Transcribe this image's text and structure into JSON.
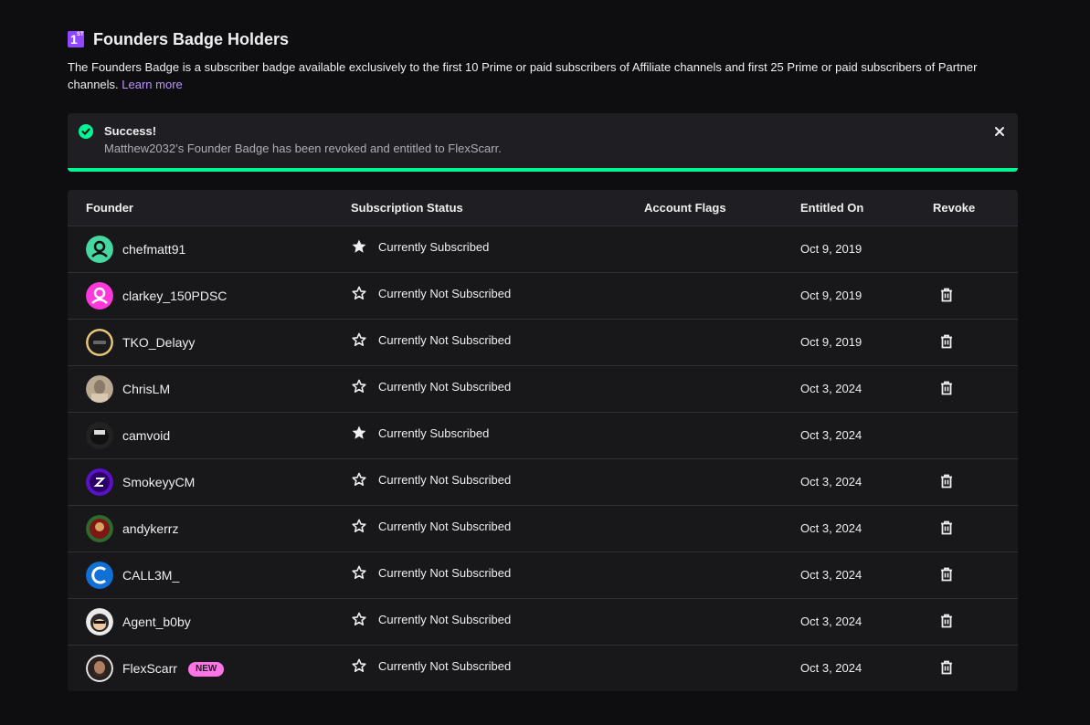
{
  "header": {
    "badge_number": "1",
    "badge_suffix": "ST",
    "title": "Founders Badge Holders",
    "description": "The Founders Badge is a subscriber badge available exclusively to the first 10 Prime or paid subscribers of Affiliate channels and first 25 Prime or paid subscribers of Partner channels.",
    "learn_more": "Learn more"
  },
  "alert": {
    "title": "Success!",
    "message": "Matthew2032’s Founder Badge has been revoked and entitled to FlexScarr.",
    "accent_color": "#00f593"
  },
  "table": {
    "columns": [
      "Founder",
      "Subscription Status",
      "Account Flags",
      "Entitled On",
      "Revoke"
    ],
    "rows": [
      {
        "name": "chefmatt91",
        "status": "Currently Subscribed",
        "subscribed": true,
        "date": "Oct 9, 2019",
        "revoke": false,
        "avatar": "default-user-teal",
        "new": false
      },
      {
        "name": "clarkey_150PDSC",
        "status": "Currently Not Subscribed",
        "subscribed": false,
        "date": "Oct 9, 2019",
        "revoke": true,
        "avatar": "default-user-pink",
        "new": false
      },
      {
        "name": "TKO_Delayy",
        "status": "Currently Not Subscribed",
        "subscribed": false,
        "date": "Oct 9, 2019",
        "revoke": true,
        "avatar": "logo-dark-gold",
        "new": false
      },
      {
        "name": "ChrisLM",
        "status": "Currently Not Subscribed",
        "subscribed": false,
        "date": "Oct 3, 2024",
        "revoke": true,
        "avatar": "photo-beige",
        "new": false
      },
      {
        "name": "camvoid",
        "status": "Currently Subscribed",
        "subscribed": true,
        "date": "Oct 3, 2024",
        "revoke": false,
        "avatar": "photo-dark",
        "new": false
      },
      {
        "name": "SmokeyyCM",
        "status": "Currently Not Subscribed",
        "subscribed": false,
        "date": "Oct 3, 2024",
        "revoke": true,
        "avatar": "logo-purple",
        "new": false
      },
      {
        "name": "andykerrz",
        "status": "Currently Not Subscribed",
        "subscribed": false,
        "date": "Oct 3, 2024",
        "revoke": true,
        "avatar": "logo-red-green",
        "new": false
      },
      {
        "name": "CALL3M_",
        "status": "Currently Not Subscribed",
        "subscribed": false,
        "date": "Oct 3, 2024",
        "revoke": true,
        "avatar": "logo-blue",
        "new": false
      },
      {
        "name": "Agent_b0by",
        "status": "Currently Not Subscribed",
        "subscribed": false,
        "date": "Oct 3, 2024",
        "revoke": true,
        "avatar": "cartoon-face",
        "new": false
      },
      {
        "name": "FlexScarr",
        "status": "Currently Not Subscribed",
        "subscribed": false,
        "date": "Oct 3, 2024",
        "revoke": true,
        "avatar": "photo-man",
        "new": true,
        "new_label": "NEW"
      }
    ]
  }
}
